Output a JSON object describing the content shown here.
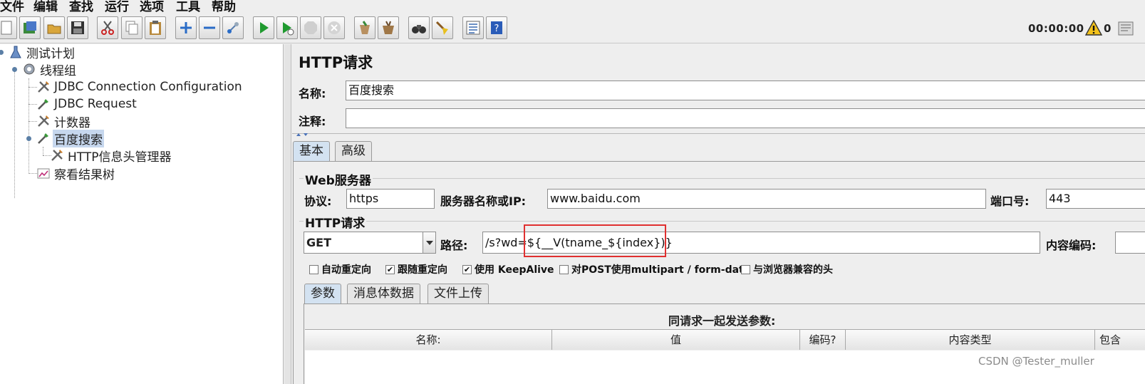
{
  "menu": [
    "文件",
    "编辑",
    "查找",
    "运行",
    "选项",
    "工具",
    "帮助"
  ],
  "toolbar": {
    "icons": [
      "new-icon",
      "templates-icon",
      "open-icon",
      "save-icon",
      "cut-icon",
      "copy-icon",
      "paste-icon",
      "expand-icon",
      "collapse-icon",
      "toggle-icon",
      "start-icon",
      "start-no-timer-icon",
      "stop-icon",
      "shutdown-icon",
      "clear-icon",
      "clear-all-icon",
      "search-icon",
      "reset-search-icon",
      "function-helper-icon",
      "help-icon"
    ],
    "timer": "00:00:00",
    "warning_count": "0"
  },
  "tree": {
    "nodes": [
      {
        "label": "测试计划",
        "icon": "test-plan-icon"
      },
      {
        "label": "线程组",
        "icon": "thread-group-icon"
      },
      {
        "label": "JDBC Connection Configuration",
        "icon": "config-element-icon"
      },
      {
        "label": "JDBC Request",
        "icon": "sampler-icon"
      },
      {
        "label": "计数器",
        "icon": "config-element-icon"
      },
      {
        "label": "百度搜索",
        "icon": "sampler-icon",
        "selected": true
      },
      {
        "label": "HTTP信息头管理器",
        "icon": "config-element-icon"
      },
      {
        "label": "察看结果树",
        "icon": "listener-icon"
      }
    ]
  },
  "panel": {
    "title": "HTTP请求",
    "name_label": "名称:",
    "name_value": "百度搜索",
    "comment_label": "注释:",
    "comment_value": "",
    "tabs": [
      "基本",
      "高级"
    ],
    "web_server": {
      "title": "Web服务器",
      "protocol_label": "协议:",
      "protocol_value": "https",
      "server_label": "服务器名称或IP:",
      "server_value": "www.baidu.com",
      "port_label": "端口号:",
      "port_value": "443"
    },
    "http_request": {
      "title": "HTTP请求",
      "method": "GET",
      "path_label": "路径:",
      "path_prefix": "/s?wd=",
      "path_variable": "${__V(tname_${index})}",
      "encoding_label": "内容编码:"
    },
    "options": [
      {
        "label": "自动重定向",
        "checked": false
      },
      {
        "label": "跟随重定向",
        "checked": true
      },
      {
        "label": "使用 KeepAlive",
        "checked": true
      },
      {
        "label": "对POST使用multipart / form-data",
        "checked": false
      },
      {
        "label": "与浏览器兼容的头",
        "checked": false
      }
    ],
    "sub_tabs": [
      "参数",
      "消息体数据",
      "文件上传"
    ],
    "params_caption": "同请求一起发送参数:",
    "columns": [
      "名称:",
      "值",
      "编码?",
      "内容类型",
      "包含"
    ]
  },
  "watermark": "CSDN @Tester_muller",
  "colors": {
    "selection": "#c6d7ee",
    "highlight": "#e03030",
    "active_tab": "#d3e2f1"
  }
}
